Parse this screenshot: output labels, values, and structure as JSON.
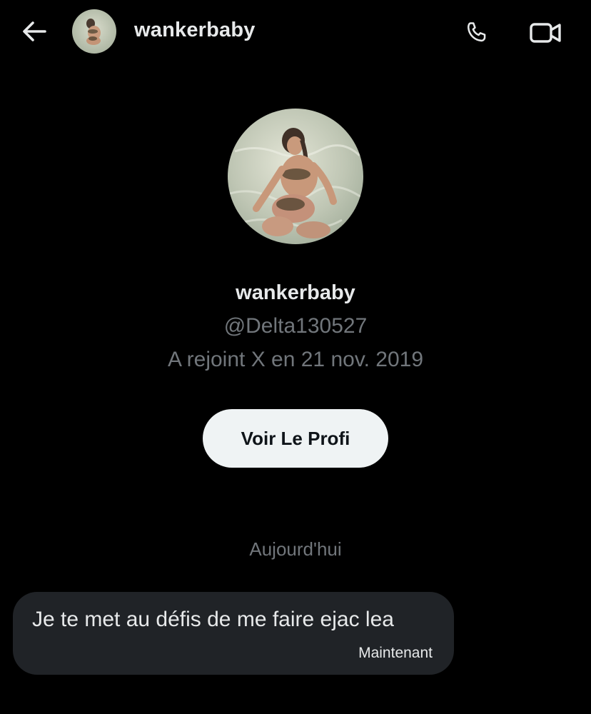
{
  "header": {
    "title": "wankerbaby",
    "back_icon": "arrow-left-icon",
    "call_icon": "phone-icon",
    "video_icon": "video-camera-icon"
  },
  "profile": {
    "name": "wankerbaby",
    "handle": "@Delta130527",
    "joined": "A rejoint X en 21 nov. 2019",
    "button_label": "Voir Le Profi"
  },
  "conversation": {
    "date_separator": "Aujourd'hui",
    "messages": [
      {
        "text": "Je te met au défis de me faire ejac lea",
        "time": "Maintenant"
      }
    ]
  },
  "colors": {
    "background": "#000000",
    "primary_text": "#e7e9ea",
    "secondary_text": "#71767b",
    "bubble": "#202327",
    "button_bg": "#eff3f4",
    "button_text": "#0f1419"
  }
}
